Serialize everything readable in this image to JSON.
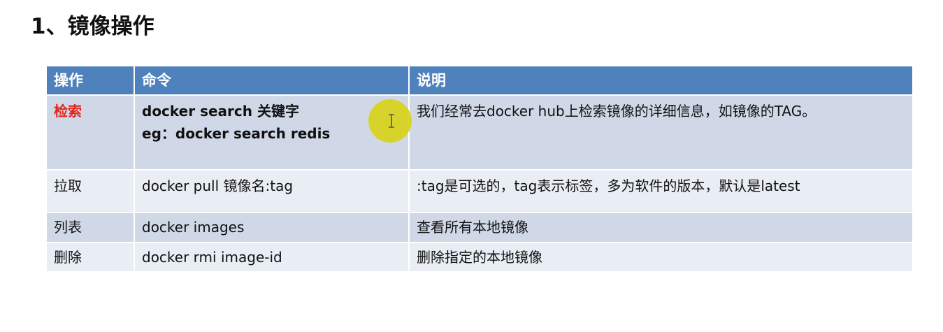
{
  "page": {
    "title": "1、镜像操作"
  },
  "table": {
    "headers": [
      "操作",
      "命令",
      "说明"
    ],
    "rows": [
      {
        "op": "检索",
        "cmd_line1": "docker search 关键字",
        "cmd_line2": "eg：docker search redis",
        "desc": "我们经常去docker hub上检索镜像的详细信息，如镜像的TAG。"
      },
      {
        "op": "拉取",
        "cmd_line1": "docker pull 镜像名:tag",
        "desc": ":tag是可选的，tag表示标签，多为软件的版本，默认是latest"
      },
      {
        "op": "列表",
        "cmd_line1": "docker images",
        "desc": "查看所有本地镜像"
      },
      {
        "op": "删除",
        "cmd_line1": "docker rmi image-id",
        "desc": "删除指定的本地镜像"
      }
    ]
  },
  "colors": {
    "header_bg": "#4f81bd",
    "row_dark": "#d0d8e8",
    "row_light": "#e9edf4",
    "highlight_red": "#e3261b",
    "cursor_yellow": "#d8d21a"
  },
  "icons": {
    "cursor": "text-cursor-icon"
  }
}
